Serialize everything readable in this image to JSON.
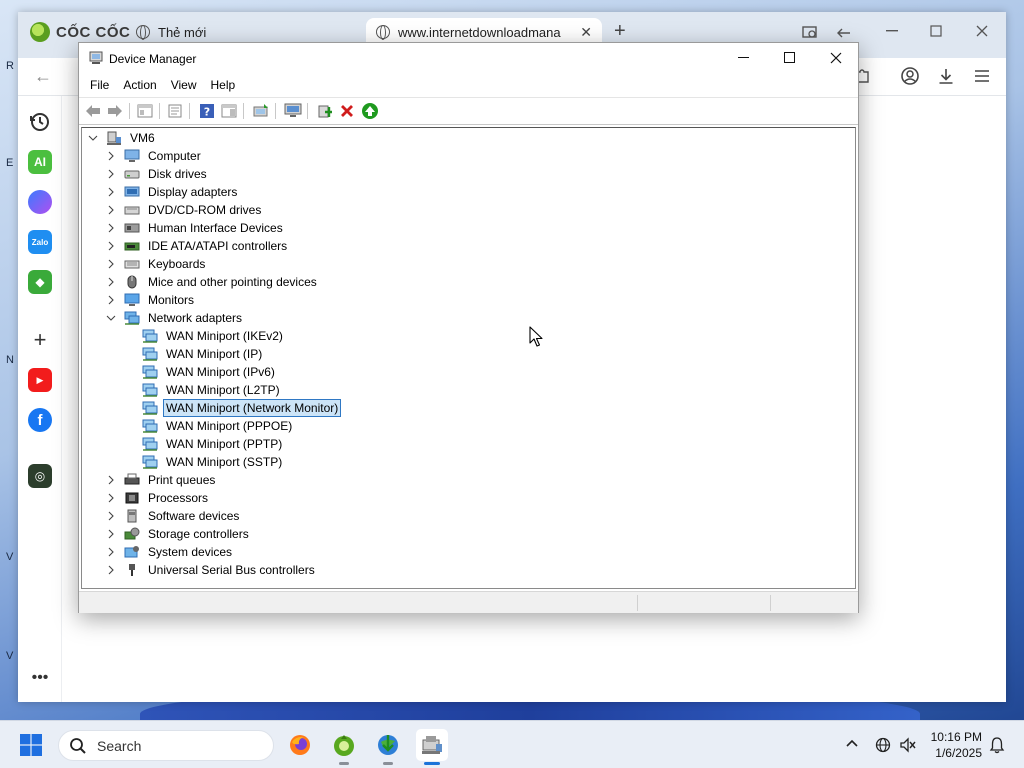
{
  "browser": {
    "brand": "CỐC CỐC",
    "tabs": [
      {
        "label": "Thẻ mới"
      },
      {
        "label": "www.internetdownloadmana"
      }
    ],
    "new_tab": "+"
  },
  "desktop_labels": [
    "R",
    "E",
    "N",
    "V",
    "V"
  ],
  "window": {
    "title": "Device Manager",
    "menu": [
      "File",
      "Action",
      "View",
      "Help"
    ]
  },
  "tree": {
    "root": "VM6",
    "categories": [
      {
        "label": "Computer",
        "icon": "computer-icon",
        "expanded": false
      },
      {
        "label": "Disk drives",
        "icon": "disk-drive-icon",
        "expanded": false
      },
      {
        "label": "Display adapters",
        "icon": "display-adapter-icon",
        "expanded": false
      },
      {
        "label": "DVD/CD-ROM drives",
        "icon": "dvd-drive-icon",
        "expanded": false
      },
      {
        "label": "Human Interface Devices",
        "icon": "hid-icon",
        "expanded": false
      },
      {
        "label": "IDE ATA/ATAPI controllers",
        "icon": "ide-controller-icon",
        "expanded": false
      },
      {
        "label": "Keyboards",
        "icon": "keyboard-icon",
        "expanded": false
      },
      {
        "label": "Mice and other pointing devices",
        "icon": "mouse-icon",
        "expanded": false
      },
      {
        "label": "Monitors",
        "icon": "monitor-icon",
        "expanded": false
      },
      {
        "label": "Network adapters",
        "icon": "network-adapter-icon",
        "expanded": true,
        "children": [
          {
            "label": "WAN Miniport (IKEv2)",
            "selected": false
          },
          {
            "label": "WAN Miniport (IP)",
            "selected": false
          },
          {
            "label": "WAN Miniport (IPv6)",
            "selected": false
          },
          {
            "label": "WAN Miniport (L2TP)",
            "selected": false
          },
          {
            "label": "WAN Miniport (Network Monitor)",
            "selected": true
          },
          {
            "label": "WAN Miniport (PPPOE)",
            "selected": false
          },
          {
            "label": "WAN Miniport (PPTP)",
            "selected": false
          },
          {
            "label": "WAN Miniport (SSTP)",
            "selected": false
          }
        ]
      },
      {
        "label": "Print queues",
        "icon": "printer-icon",
        "expanded": false
      },
      {
        "label": "Processors",
        "icon": "processor-icon",
        "expanded": false
      },
      {
        "label": "Software devices",
        "icon": "software-device-icon",
        "expanded": false
      },
      {
        "label": "Storage controllers",
        "icon": "storage-controller-icon",
        "expanded": false
      },
      {
        "label": "System devices",
        "icon": "system-device-icon",
        "expanded": false
      },
      {
        "label": "Universal Serial Bus controllers",
        "icon": "usb-icon",
        "expanded": false
      }
    ]
  },
  "taskbar": {
    "search_label": "Search",
    "time": "10:16 PM",
    "date": "1/6/2025"
  },
  "colors": {
    "selection_fill": "#cce4f7",
    "selection_border": "#2f78c4",
    "taskbar_active": "#1a73d9"
  }
}
